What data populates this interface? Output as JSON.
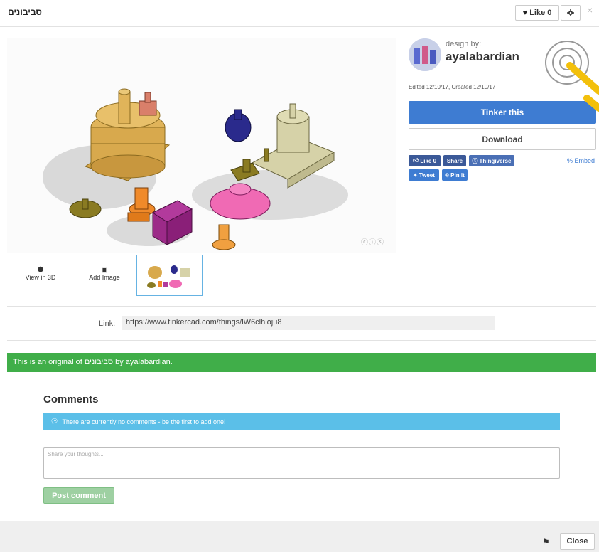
{
  "header": {
    "title": "סביבונים",
    "like_label": "Like",
    "like_count": "0",
    "close_symbol": "×"
  },
  "preview": {
    "license_mark": "ⓒⓘⓢ"
  },
  "thumbs": {
    "view3d_label": "View in 3D",
    "addimage_label": "Add Image"
  },
  "link": {
    "label": "Link:",
    "url": "https://www.tinkercad.com/things/lW6clhioju8"
  },
  "original_notice": "This is an original of סביבונים by ayalabardian.",
  "sidebar": {
    "design_by": "design by:",
    "author": "ayalabardian",
    "edited": "Edited 12/10/17, Created 12/10/17",
    "tinker_label": "Tinker this",
    "download_label": "Download",
    "social": {
      "like": "Like 0",
      "share": "Share",
      "thingiverse": "Thingiverse",
      "tweet": "Tweet",
      "pinit": "Pin it",
      "embed": "Embed"
    }
  },
  "comments": {
    "title": "Comments",
    "info": "There are currently no comments - be the first to add one!",
    "placeholder": "Share your thoughts...",
    "post_label": "Post comment"
  },
  "footer": {
    "close_label": "Close"
  },
  "colors": {
    "accent_blue": "#3e7cd2",
    "notice_green": "#40ae49",
    "info_blue": "#5bbfe8",
    "facebook_blue": "#3b5998"
  }
}
